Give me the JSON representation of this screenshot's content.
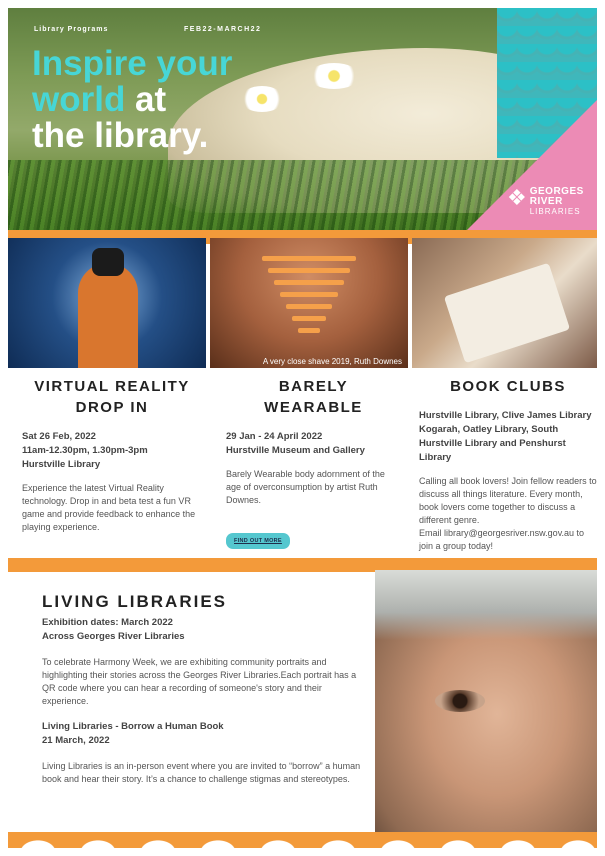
{
  "hero": {
    "tag_left": "Library Programs",
    "tag_right": "FEB22-MARCH22",
    "headline_teal": "Inspire your",
    "headline_teal2": "world",
    "headline_white1": " at",
    "headline_white2": "the library.",
    "logo_line1": "GEORGES",
    "logo_line2": "RIVER",
    "logo_line3": "LIBRARIES",
    "logo_icon": "dragon-logo-icon",
    "colors": {
      "teal": "#47d6d6",
      "orange": "#f39a3a",
      "pink": "#ec8bb5",
      "button": "#55c7cf"
    }
  },
  "photos": {
    "caption_barely": "A very close shave 2019, Ruth Downes"
  },
  "vr": {
    "title_line1": "VIRTUAL REALITY",
    "title_line2": "DROP IN",
    "date1": "Sat 26 Feb, 2022",
    "date2": "11am-12.30pm, 1.30pm-3pm",
    "date3": "Hurstville Library",
    "body": "Experience the latest Virtual Reality technology. Drop in and beta test a fun VR game and provide feedback to enhance the playing experience."
  },
  "barely": {
    "title_line1": "BARELY",
    "title_line2": "WEARABLE",
    "date1": "29 Jan - 24 April 2022",
    "date2": "Hurstville Museum and Gallery",
    "body": "Barely Wearable body adornment of the age of overconsumption by artist Ruth Downes.",
    "button": "FIND OUT MORE"
  },
  "bookclubs": {
    "title": "BOOK CLUBS",
    "locations": "Hurstville Library, Clive James Library Kogarah, Oatley Library, South Hurstville Library and Penshurst Library",
    "body": "Calling all book lovers! Join fellow readers to discuss all things literature. Every month, book lovers come together to discuss a different genre.",
    "email": "Email library@georgesriver.nsw.gov.au to join a group today!"
  },
  "living": {
    "title": "LIVING LIBRARIES",
    "sub1": "Exhibition dates: March 2022",
    "sub2": "Across Georges River Libraries",
    "body1": "To celebrate Harmony Week, we are exhibiting community portraits and highlighting their stories across the Georges River Libraries.Each portrait has a QR code where you can hear a recording of someone's story and their experience.",
    "event_title": "Living Libraries - Borrow a Human Book",
    "event_date": "21 March, 2022",
    "body2": "Living Libraries is an in-person event where you are invited to “borrow” a human book and hear their story. It’s a chance to challenge stigmas and stereotypes."
  }
}
